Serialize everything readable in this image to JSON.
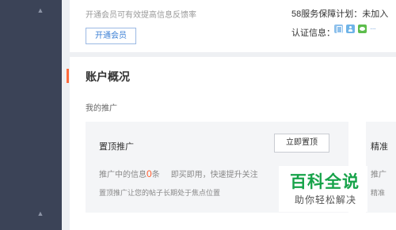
{
  "sidebar": {
    "chevrons": [
      "up",
      "up"
    ]
  },
  "account_card": {
    "vip_hint": "开通会员可有效提高信息反馈率",
    "vip_button": "开通会员",
    "guarantee_label": "58服务保障计划：未加入",
    "verify_label": "认证信息：",
    "verify_icons": [
      "phone-icon",
      "person-icon",
      "wechat-icon",
      "more-icon"
    ],
    "more_glyph": "···"
  },
  "overview": {
    "title": "账户概况",
    "accent_color": "#ff6a3c",
    "section_label": "我的推广",
    "top_promo": {
      "title": "置顶推广",
      "button": "立即置顶",
      "info_prefix": "推广中的信息",
      "info_count": "0",
      "info_suffix": "条",
      "instant_text": "即买即用，快速提升关注",
      "description": "置顶推广让您的帖子长期处于焦点位置"
    },
    "precise_promo": {
      "title": "精准",
      "line1": "推广",
      "line2": "精准"
    }
  },
  "watermark": {
    "big": "百科全说",
    "small": "助你轻松解决",
    "color": "#17a34a"
  }
}
